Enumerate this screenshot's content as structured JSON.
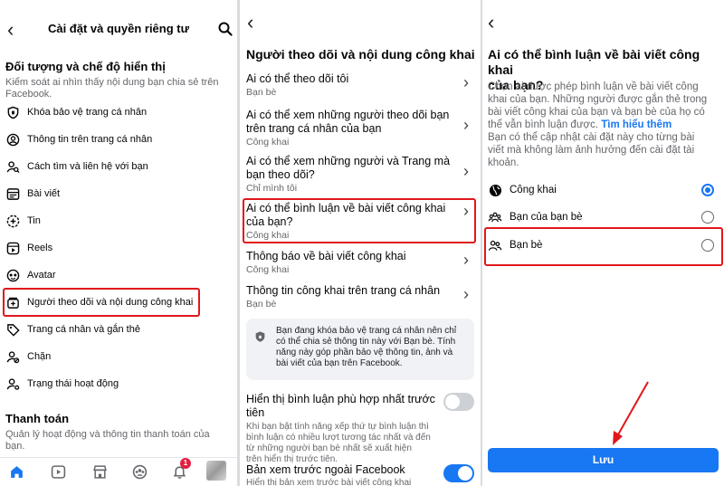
{
  "panel1": {
    "header": {
      "title": "Cài đặt và quyền riêng tư"
    },
    "section1": {
      "heading": "Đối tượng và chế độ hiển thị",
      "desc_line1": "Kiểm soát ai nhìn thấy nội dung bạn chia sẻ trên",
      "desc_line2": "Facebook."
    },
    "items": [
      {
        "label": "Khóa bảo vệ trang cá nhân",
        "icon": "shield-icon"
      },
      {
        "label": "Thông tin trên trang cá nhân",
        "icon": "profile-icon"
      },
      {
        "label": "Cách tìm và liên hệ với bạn",
        "icon": "find-person-icon"
      },
      {
        "label": "Bài viết",
        "icon": "posts-icon"
      },
      {
        "label": "Tin",
        "icon": "story-plus-icon"
      },
      {
        "label": "Reels",
        "icon": "reels-icon"
      },
      {
        "label": "Avatar",
        "icon": "avatar-icon"
      },
      {
        "label": "Người theo dõi và nội dung công khai",
        "icon": "followers-icon"
      },
      {
        "label": "Trang cá nhân và gắn thẻ",
        "icon": "tag-icon"
      },
      {
        "label": "Chặn",
        "icon": "block-icon"
      },
      {
        "label": "Trạng thái hoạt động",
        "icon": "activity-icon"
      }
    ],
    "section2": {
      "heading": "Thanh toán",
      "desc_line1": "Quản lý hoạt động và thông tin thanh toán của",
      "desc_line2": "bạn."
    },
    "bottom_nav": {
      "notification_badge": "1"
    }
  },
  "panel2": {
    "title": "Người theo dõi và nội dung công khai",
    "items": [
      {
        "title_line1": "Ai có thể theo dõi tôi",
        "title_line2": "",
        "sub": "Bạn bè"
      },
      {
        "title_line1": "Ai có thể xem những người theo dõi bạn",
        "title_line2": "trên trang cá nhân của bạn",
        "sub": "Công khai"
      },
      {
        "title_line1": "Ai có thể xem những người và Trang mà",
        "title_line2": "bạn theo dõi?",
        "sub": "Chỉ mình tôi"
      },
      {
        "title_line1": "Ai có thể bình luận về bài viết công khai",
        "title_line2": "của bạn?",
        "sub": "Công khai"
      },
      {
        "title_line1": "Thông báo về bài viết công khai",
        "title_line2": "",
        "sub": "Công khai"
      },
      {
        "title_line1": "Thông tin công khai trên trang cá nhân",
        "title_line2": "",
        "sub": "Bạn bè"
      }
    ],
    "notice": {
      "line1": "Bạn đang khóa bảo vệ trang cá nhân nên chỉ",
      "line2": "có thể chia sẻ thông tin này với Bạn bè. Tính",
      "line3": "năng này góp phần bảo vệ thông tin, ảnh và",
      "line4": "bài viết của bạn trên Facebook."
    },
    "toggle1": {
      "title_line1": "Hiển thị bình luận phù hợp nhất trước",
      "title_line2": "tiên",
      "desc_line1": "Khi bạn bật tính năng xếp thứ tự bình luận thì",
      "desc_line2": "bình luận có nhiều lượt tương tác nhất và đến",
      "desc_line3": "từ những người bạn bè nhất sẽ xuất hiện",
      "desc_line4": "trên hiển thị trước tiên.",
      "on": false
    },
    "toggle2": {
      "title": "Bản xem trước ngoài Facebook",
      "desc": "Hiển thị bản xem trước bài viết công khai",
      "on": true
    }
  },
  "panel3": {
    "title_line1": "Ai có thể bình luận về bài viết công khai",
    "title_line2": "của bạn?",
    "desc_line1": "Chọn ai được phép bình luận về bài viết công",
    "desc_line2": "khai của bạn. Những người được gắn thẻ trong",
    "desc_line3": "bài viết công khai của bạn và bạn bè của họ có",
    "desc_line4_pre": "thể vẫn bình luận được. ",
    "desc_link": "Tìm hiểu thêm",
    "desc_line5": "Bạn có thể cập nhật cài đặt này cho từng bài",
    "desc_line6": "viết mà không làm ảnh hưởng đến cài đặt tài",
    "desc_line7": "khoản.",
    "options": [
      {
        "label": "Công khai",
        "icon": "globe-icon",
        "selected": true
      },
      {
        "label": "Bạn của bạn bè",
        "icon": "friends-of-friends-icon",
        "selected": false
      },
      {
        "label": "Bạn bè",
        "icon": "friends-icon",
        "selected": false
      }
    ],
    "save_label": "Lưu"
  },
  "colors": {
    "accent": "#1877f2",
    "highlight": "#e0171b",
    "muted": "#65676b"
  }
}
